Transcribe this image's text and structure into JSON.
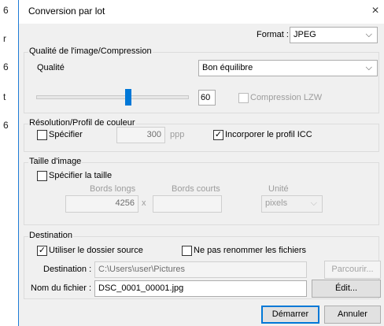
{
  "edge_chars": [
    "6",
    "r",
    "6",
    "t",
    "6"
  ],
  "dialog": {
    "title": "Conversion par lot",
    "close_glyph": "×"
  },
  "format": {
    "label": "Format :",
    "value": "JPEG"
  },
  "quality_group": {
    "title": "Qualité de l'image/Compression",
    "quality_label": "Qualité",
    "quality_value": "Bon équilibre",
    "slider_level": 60,
    "slider_value_text": "60",
    "lzw_label": "Compression LZW",
    "lzw_checked": false
  },
  "resolution_group": {
    "title": "Résolution/Profil de couleur",
    "specify_label": "Spécifier",
    "specify_checked": false,
    "resolution_value": "300",
    "resolution_unit": "ppp",
    "icc_label": "Incorporer le profil ICC",
    "icc_checked": true
  },
  "size_group": {
    "title": "Taille d'image",
    "specify_size_label": "Spécifier la taille",
    "specify_size_checked": false,
    "long_edge_label": "Bords longs",
    "long_edge_value": "4256",
    "times_glyph": "x",
    "short_edge_label": "Bords courts",
    "short_edge_value": "",
    "unit_label": "Unité",
    "unit_value": "pixels"
  },
  "destination_group": {
    "title": "Destination",
    "use_source_label": "Utiliser le dossier source",
    "use_source_checked": true,
    "no_rename_label": "Ne pas renommer les fichiers",
    "no_rename_checked": false,
    "destination_label": "Destination :",
    "destination_value": "C:\\Users\\user\\Pictures",
    "browse_label": "Parcourir...",
    "filename_label": "Nom du fichier :",
    "filename_value": "DSC_0001_00001.jpg",
    "edit_label": "Édit..."
  },
  "buttons": {
    "start_label": "Démarrer",
    "cancel_label": "Annuler"
  },
  "glyphs": {
    "check": "✓",
    "chevron": "⌵"
  },
  "colors": {
    "accent": "#0078d7",
    "frame": "#1e7bd6",
    "dialog_bg": "#f0f0f0"
  }
}
